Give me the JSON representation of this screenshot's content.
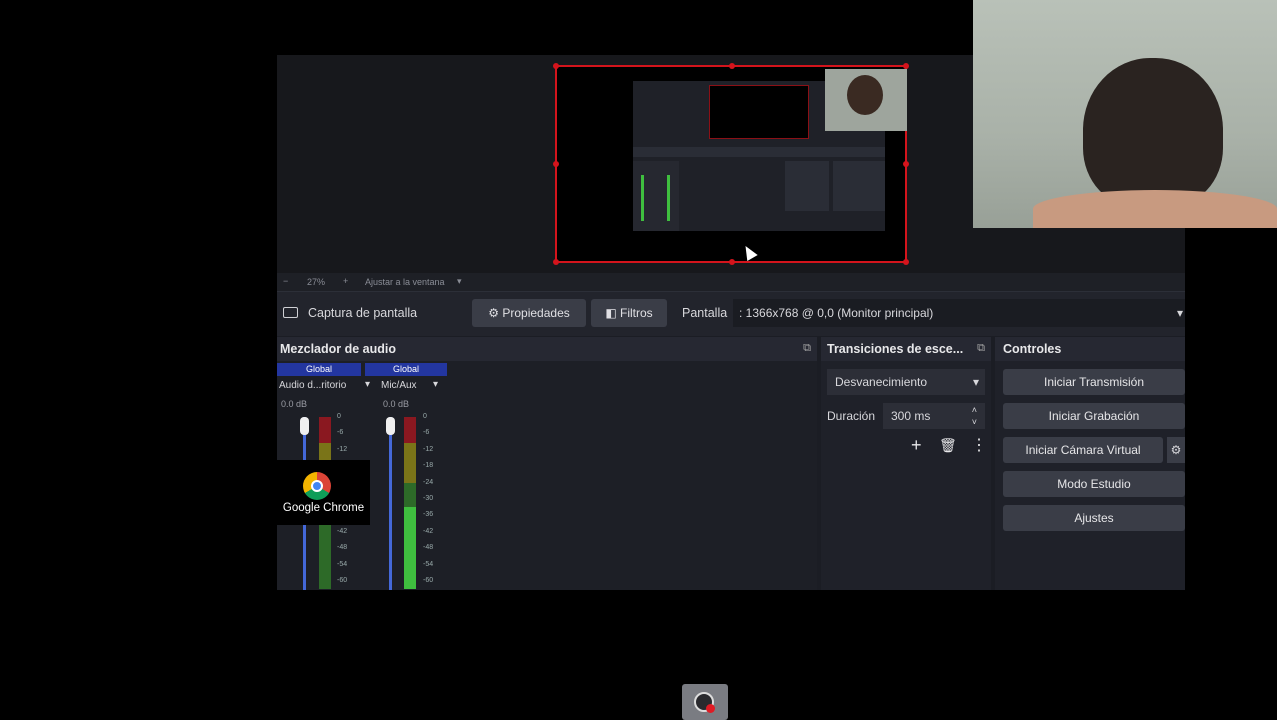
{
  "preview": {
    "zoom": "27%",
    "fit_label": "Ajustar a la ventana"
  },
  "source_bar": {
    "source_name": "Captura de pantalla",
    "properties_label": "Propiedades",
    "filters_label": "Filtros",
    "screen_label": "Pantalla",
    "screen_value": ": 1366x768 @ 0,0 (Monitor principal)"
  },
  "mixer": {
    "title": "Mezclador de audio",
    "channels": [
      {
        "group": "Global",
        "name": "Audio d...ritorio",
        "db": "0.0 dB"
      },
      {
        "group": "Global",
        "name": "Mic/Aux",
        "db": "0.0 dB"
      }
    ],
    "ticks": [
      "0",
      "-6",
      "-12",
      "-18",
      "-24",
      "-30",
      "-36",
      "-42",
      "-48",
      "-54",
      "-60"
    ]
  },
  "transitions": {
    "title": "Transiciones de esce...",
    "selected": "Desvanecimiento",
    "duration_label": "Duración",
    "duration_value": "300 ms"
  },
  "controls": {
    "title": "Controles",
    "buttons": [
      "Iniciar Transmisión",
      "Iniciar Grabación",
      "Iniciar Cámara Virtual",
      "Modo Estudio",
      "Ajustes"
    ]
  },
  "desktop": {
    "chrome_label": "Google Chrome"
  },
  "colors": {
    "accent_red": "#d4141c",
    "mixer_header_blue": "#2336a0",
    "meter_green": "#3fbf3f",
    "meter_red": "#8a1820"
  }
}
